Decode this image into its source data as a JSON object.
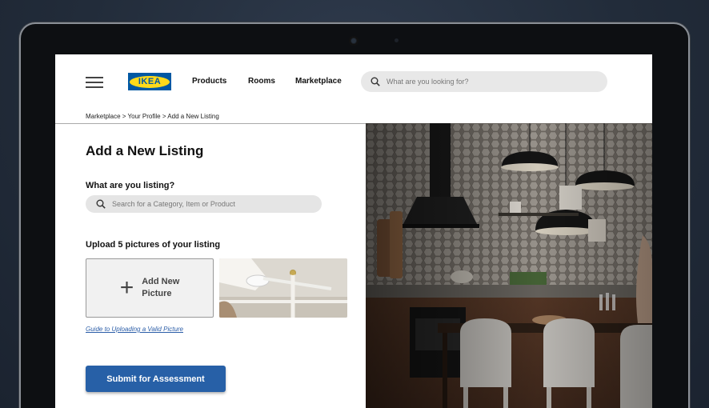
{
  "header": {
    "logo_text": "IKEA",
    "nav": [
      "Products",
      "Rooms",
      "Marketplace"
    ],
    "search_placeholder": "What are you looking for?"
  },
  "breadcrumb": "Marketplace > Your Profile > Add a New Listing",
  "page_title": "Add a New Listing",
  "listing_question": "What are you listing?",
  "category_search_placeholder": "Search for a Category, Item or Product",
  "upload_heading": "Upload 5 pictures of your listing",
  "add_picture": {
    "line1": "Add New",
    "line2": "Picture"
  },
  "guide_link": "Guide to Uploading a Valid Picture",
  "submit_label": "Submit for Assessment",
  "colors": {
    "ikea_blue": "#0058a3",
    "ikea_yellow": "#ffda1a",
    "submit_blue": "#2760a7"
  },
  "icons": [
    "hamburger-menu-icon",
    "search-icon",
    "plus-icon"
  ]
}
